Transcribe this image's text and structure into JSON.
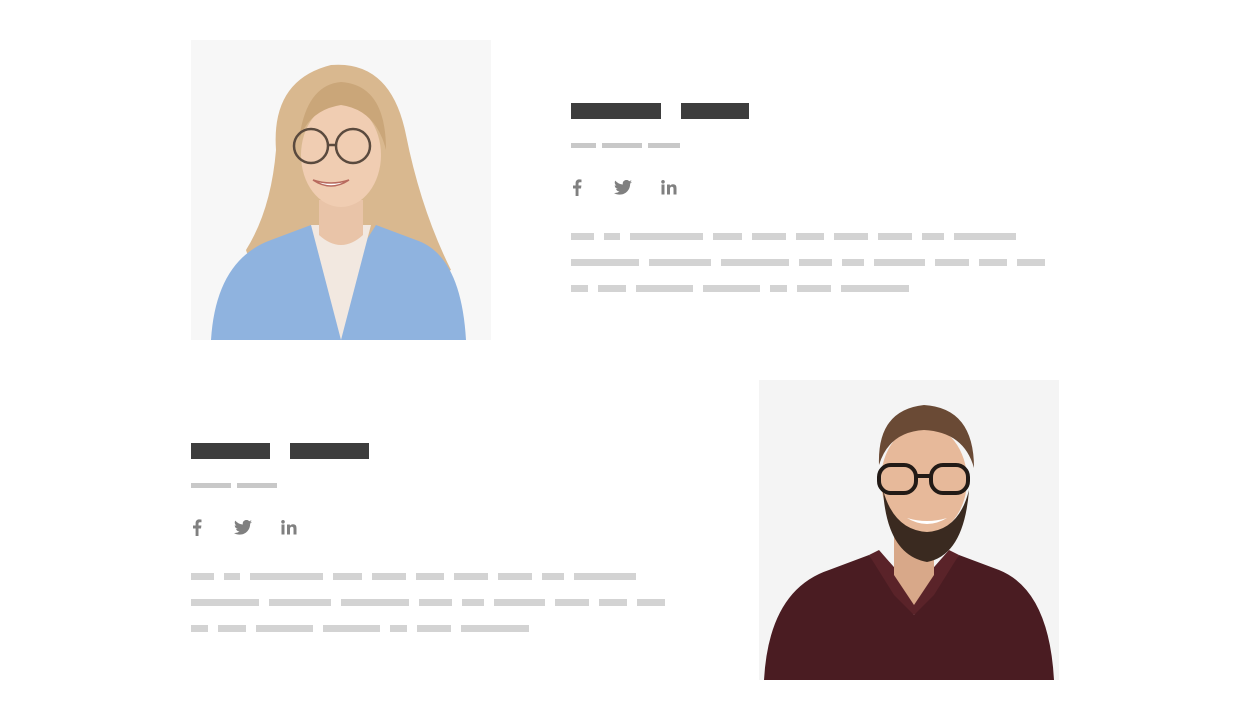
{
  "team": [
    {
      "photo_icon": "woman-portrait-photo",
      "social_icons": [
        "facebook-icon",
        "twitter-icon",
        "linkedin-icon"
      ]
    },
    {
      "photo_icon": "man-portrait-photo",
      "social_icons": [
        "facebook-icon",
        "twitter-icon",
        "linkedin-icon"
      ]
    }
  ],
  "colors": {
    "name_placeholder": "#3d3d3d",
    "role_placeholder": "#c8c8c8",
    "text_placeholder": "#d3d3d3",
    "icon": "#808080",
    "photo_bg": "#f6f6f6"
  }
}
